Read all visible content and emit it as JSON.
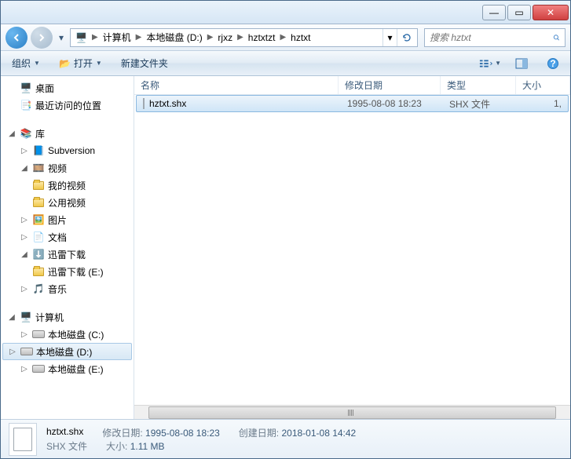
{
  "titlebar": {
    "min": "—",
    "max": "▭",
    "close": "✕"
  },
  "breadcrumbs": [
    "计算机",
    "本地磁盘 (D:)",
    "rjxz",
    "hztxtzt",
    "hztxt"
  ],
  "search": {
    "placeholder": "搜索 hztxt"
  },
  "toolbar": {
    "organize": "组织",
    "open": "打开",
    "newfolder": "新建文件夹"
  },
  "columns": {
    "name": "名称",
    "date": "修改日期",
    "type": "类型",
    "size": "大小"
  },
  "sidebar": {
    "desktop": "桌面",
    "recent": "最近访问的位置",
    "libraries": "库",
    "subversion": "Subversion",
    "video": "视频",
    "myvideo": "我的视频",
    "publicvideo": "公用视频",
    "pictures": "图片",
    "documents": "文档",
    "xunlei": "迅雷下载",
    "xunleiE": "迅雷下载 (E:)",
    "music": "音乐",
    "computer": "计算机",
    "driveC": "本地磁盘 (C:)",
    "driveD": "本地磁盘 (D:)",
    "driveE": "本地磁盘 (E:)"
  },
  "files": [
    {
      "name": "hztxt.shx",
      "date": "1995-08-08 18:23",
      "type": "SHX 文件",
      "size": "1,"
    }
  ],
  "details": {
    "name": "hztxt.shx",
    "type": "SHX 文件",
    "modLabel": "修改日期:",
    "modVal": "1995-08-08 18:23",
    "createLabel": "创建日期:",
    "createVal": "2018-01-08 14:42",
    "sizeLabel": "大小:",
    "sizeVal": "1.11 MB"
  }
}
